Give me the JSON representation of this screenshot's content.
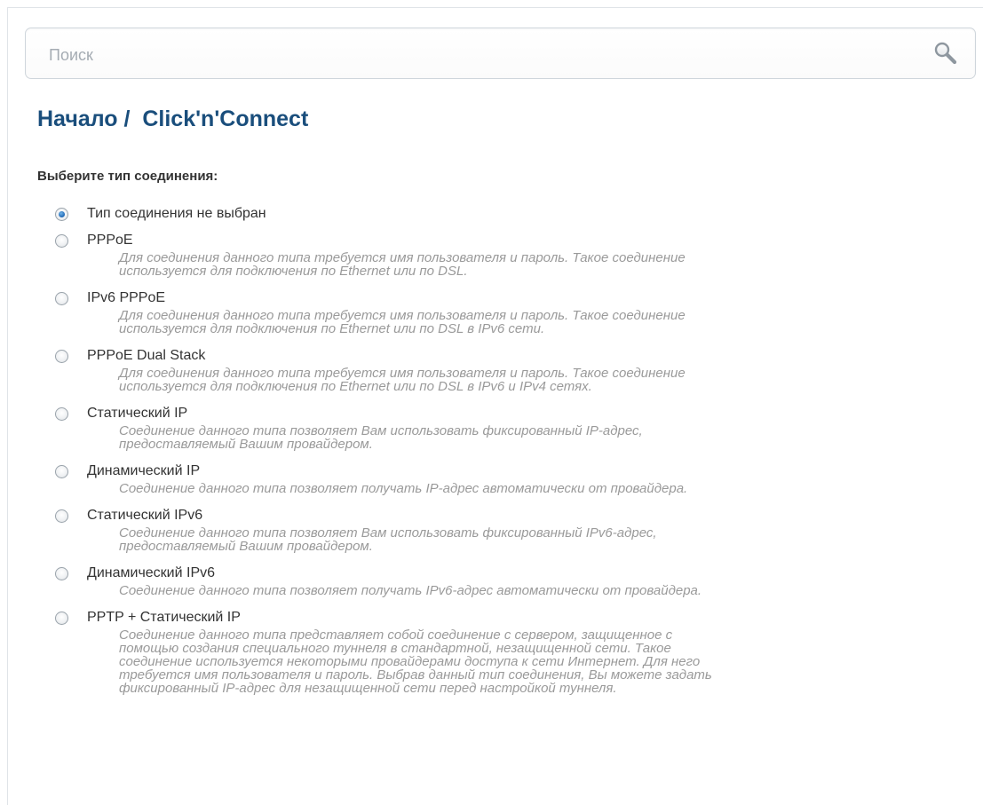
{
  "search": {
    "placeholder": "Поиск",
    "value": ""
  },
  "header": {
    "title": "Начало /  Click'n'Connect"
  },
  "main": {
    "section_label": "Выберите тип соединения:",
    "selected_index": 0,
    "options": [
      {
        "label": "Тип соединения не выбран",
        "description": "",
        "checked": true
      },
      {
        "label": "PPPoE",
        "description": "Для соединения данного типа требуется имя пользователя и пароль. Такое соединение\nиспользуется для подключения по Ethernet или по DSL.",
        "checked": false
      },
      {
        "label": "IPv6 PPPoE",
        "description": "Для соединения данного типа требуется имя пользователя и пароль. Такое соединение\nиспользуется для подключения по Ethernet или по DSL в IPv6 сети.",
        "checked": false
      },
      {
        "label": "PPPoE Dual Stack",
        "description": "Для соединения данного типа требуется имя пользователя и пароль. Такое соединение\nиспользуется для подключения по Ethernet или по DSL в IPv6 и IPv4 сетях.",
        "checked": false
      },
      {
        "label": "Статический IP",
        "description": "Соединение данного типа позволяет Вам использовать фиксированный IP-адрес,\nпредоставляемый Вашим провайдером.",
        "checked": false
      },
      {
        "label": "Динамический IP",
        "description": "Соединение данного типа позволяет получать IP-адрес автоматически от провайдера.",
        "checked": false
      },
      {
        "label": "Статический IPv6",
        "description": "Соединение данного типа позволяет Вам использовать фиксированный IPv6-адрес,\nпредоставляемый Вашим провайдером.",
        "checked": false
      },
      {
        "label": "Динамический IPv6",
        "description": "Соединение данного типа позволяет получать IPv6-адрес автоматически от провайдера.",
        "checked": false
      },
      {
        "label": "PPTP + Статический IP",
        "description": "Соединение данного типа представляет собой соединение с сервером, защищенное с\nпомощью создания специального туннеля в стандартной, незащищенной сети. Такое\nсоединение используется некоторыми провайдерами доступа к сети Интернет. Для него\nтребуется имя пользователя и пароль. Выбрав данный тип соединения, Вы можете задать\nфиксированный IP-адрес для незащищенной сети перед настройкой туннеля.",
        "checked": false
      }
    ]
  },
  "icons": {
    "search": "search-icon",
    "radio_checked": "radio-checked-icon",
    "radio_unchecked": "radio-unchecked-icon"
  },
  "colors": {
    "title": "#1a4e7c",
    "label": "#333333",
    "description": "#9a9a9a",
    "radio_dot": "#1e67b4"
  }
}
